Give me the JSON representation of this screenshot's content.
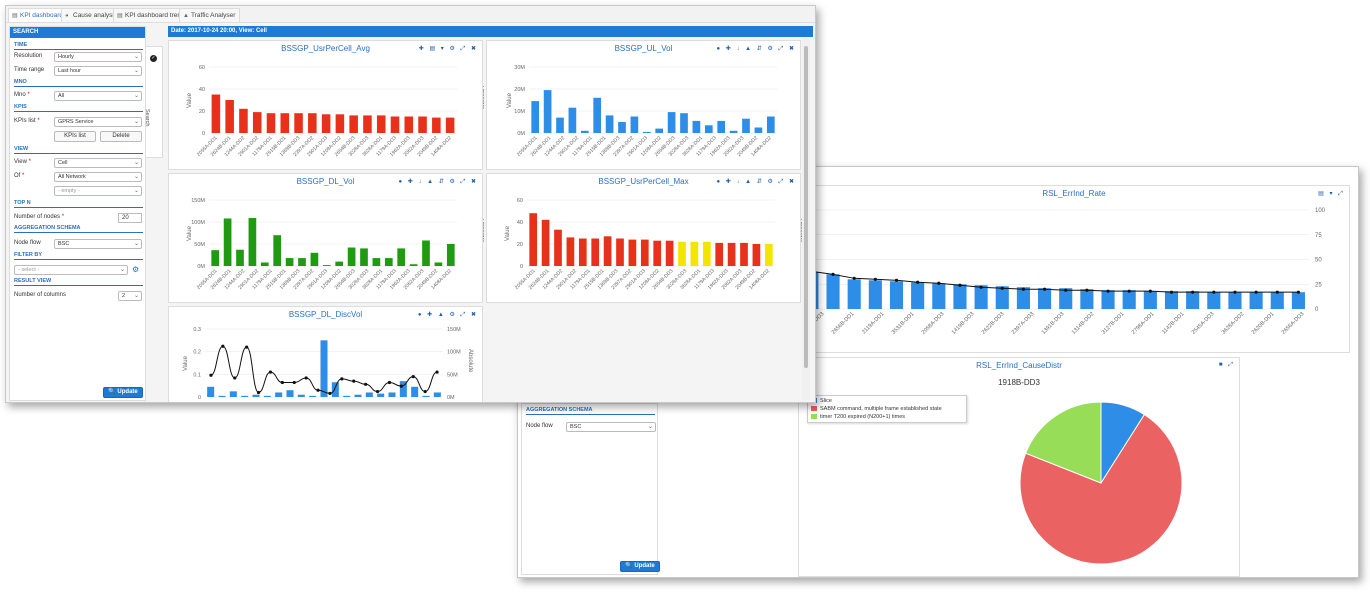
{
  "tabs": [
    {
      "label": "KPI dashboard",
      "icon": "chart-icon",
      "active": true
    },
    {
      "label": "Cause analysis",
      "icon": "pie-icon",
      "active": false
    },
    {
      "label": "KPI dashboard trend",
      "icon": "chart-icon",
      "active": false
    },
    {
      "label": "Traffic Analyser",
      "icon": "area-chart-icon",
      "active": false
    }
  ],
  "sidebar": {
    "title": "SEARCH",
    "sections": {
      "time": "TIME",
      "mno": "MNO",
      "kpis": "KPIS",
      "view": "VIEW",
      "topn": "TOP N",
      "aggregation": "AGGREGATION SCHEMA",
      "filter": "FILTER BY",
      "result": "RESULT VIEW"
    },
    "labels": {
      "resolution": "Resolution",
      "time_range": "Time range",
      "mno": "Mno",
      "kpis_list": "KPIs list",
      "view": "View",
      "of": "Of",
      "number_of_nodes": "Number of nodes",
      "node_flow": "Node flow",
      "number_of_columns": "Number of columns"
    },
    "values": {
      "resolution": "Hourly",
      "time_range": "Last hour",
      "mno": "All",
      "kpis_list": "GPRS Service",
      "view": "Cell",
      "of": "All Network",
      "of2_placeholder": "- empty -",
      "number_of_nodes": "20",
      "node_flow": "BSC",
      "filter_placeholder": "- select -",
      "number_of_columns": "2"
    },
    "buttons": {
      "kpis_list": "KPIs list",
      "delete": "Delete",
      "update": "Update"
    },
    "required_mark": "*",
    "search_tab": "Search"
  },
  "date_bar": "Date: 2017-10-24 20:00, View: Cell",
  "back_window": {
    "aggregation": "AGGREGATION SCHEMA",
    "node_flow_label": "Node flow",
    "node_flow_value": "BSC",
    "update": "Update"
  },
  "colors": {
    "accent": "#1f7ad6",
    "blue_bar": "#2e8de6",
    "red_bar": "#e8311a",
    "green_bar": "#1f9a12",
    "yellow_bar": "#f2e600",
    "pie_red": "#ea6262",
    "pie_green": "#97dd57",
    "pie_blue": "#2e8de6"
  },
  "chart_data": [
    {
      "id": "c1",
      "type": "bar",
      "title": "BSSGP_UsrPerCell_Avg",
      "ylabel": "Value",
      "y2label": "Absolute",
      "ylim": [
        0,
        60
      ],
      "yticks": [
        "0",
        "20",
        "40",
        "60"
      ],
      "categories": [
        "2055A-DD1",
        "2624B-DD1",
        "1244A-DD2",
        "2901A-DD2",
        "1179A-DD1",
        "2515B-DD1",
        "1369B-DD3",
        "2397A-DD2",
        "2901A-DD3",
        "1209A-DD2",
        "2654B-DD3",
        "3028A-DD3",
        "3628A-DD1",
        "1179A-DD3",
        "1962A-DD3",
        "2062A-DD3",
        "2049B-DD2",
        "1408A-DD2"
      ],
      "values": [
        35,
        30,
        22,
        19,
        18,
        18,
        18,
        18,
        17,
        17,
        16,
        16,
        16,
        15,
        15,
        15,
        14,
        14
      ],
      "colors": [
        "red"
      ]
    },
    {
      "id": "c2",
      "type": "bar",
      "title": "BSSGP_UL_Vol",
      "ylabel": "Value",
      "y2label": "Absolute",
      "ylim": [
        0,
        30
      ],
      "yticks": [
        "0M",
        "10M",
        "20M",
        "30M"
      ],
      "categories": [
        "2055A-DD1",
        "2624B-DD1",
        "1244A-DD2",
        "2901A-DD2",
        "1179A-DD1",
        "2515B-DD1",
        "1369B-DD3",
        "2397A-DD2",
        "2901A-DD3",
        "1209A-DD2",
        "2654B-DD3",
        "3028A-DD3",
        "3628A-DD1",
        "1179A-DD3",
        "1962A-DD3",
        "2062A-DD3",
        "2049B-DD2",
        "1408A-DD2"
      ],
      "values": [
        14.5,
        19.5,
        7,
        11.5,
        1,
        16,
        8,
        5,
        7.5,
        0.5,
        2,
        9.5,
        9,
        5.5,
        3.5,
        5.5,
        1,
        6.5,
        2.5,
        7.5
      ],
      "colors": [
        "blue"
      ]
    },
    {
      "id": "c3",
      "type": "bar",
      "title": "BSSGP_DL_Vol",
      "ylabel": "Value",
      "y2label": "Absolute",
      "ylim": [
        0,
        150
      ],
      "yticks": [
        "0M",
        "50M",
        "100M",
        "150M"
      ],
      "categories": [
        "2055A-DD1",
        "2624B-DD1",
        "1244A-DD2",
        "2901A-DD2",
        "1179A-DD1",
        "2515B-DD1",
        "1369B-DD3",
        "2397A-DD2",
        "2901A-DD3",
        "1209A-DD2",
        "2654B-DD3",
        "3028A-DD3",
        "3628A-DD1",
        "1179A-DD3",
        "1962A-DD3",
        "2062A-DD3",
        "2049B-DD2",
        "1408A-DD2"
      ],
      "values": [
        36,
        108,
        37,
        109,
        8,
        70,
        18,
        18,
        30,
        2,
        10,
        42,
        40,
        18,
        18,
        40,
        4,
        58,
        8,
        50
      ],
      "colors": [
        "green"
      ]
    },
    {
      "id": "c4",
      "type": "bar",
      "title": "BSSGP_UsrPerCell_Max",
      "ylabel": "Value",
      "y2label": "Absolute",
      "ylim": [
        0,
        60
      ],
      "yticks": [
        "0",
        "20",
        "40",
        "60"
      ],
      "categories": [
        "2055A-DD1",
        "2624B-DD1",
        "1244A-DD2",
        "2901A-DD2",
        "1179A-DD1",
        "2515B-DD1",
        "1369B-DD3",
        "2397A-DD2",
        "2901A-DD3",
        "1209A-DD2",
        "2654B-DD3",
        "3028A-DD3",
        "3628A-DD1",
        "1179A-DD3",
        "1962A-DD3",
        "2062A-DD3",
        "2049B-DD2",
        "1408A-DD2"
      ],
      "values": [
        48,
        42,
        33,
        26,
        25,
        25,
        27,
        25,
        24,
        24,
        23,
        23,
        22,
        22,
        22,
        21,
        21,
        21,
        20,
        20
      ],
      "bar_colors": [
        "red",
        "red",
        "red",
        "red",
        "red",
        "red",
        "red",
        "red",
        "red",
        "red",
        "red",
        "red",
        "yellow",
        "yellow",
        "yellow",
        "red",
        "red",
        "red",
        "red",
        "yellow",
        "red",
        "red"
      ]
    },
    {
      "id": "c5",
      "type": "bar",
      "title": "BSSGP_DL_DiscVol",
      "ylabel": "Value",
      "y2label": "Absolute",
      "ylim": [
        0,
        0.3
      ],
      "yticks": [
        "0",
        "0.1",
        "0.2",
        "0.3"
      ],
      "y2ticks": [
        "0M",
        "50M",
        "100M",
        "150M"
      ],
      "values": [
        0.045,
        0.005,
        0.025,
        0.005,
        0.01,
        0.005,
        0.02,
        0.03,
        0.01,
        0.005,
        0.25,
        0.065,
        0.005,
        0.01,
        0.02,
        0.015,
        0.02,
        0.07,
        0.045,
        0.005,
        0.02
      ],
      "line": [
        48,
        112,
        42,
        110,
        10,
        55,
        32,
        32,
        42,
        15,
        8,
        40,
        35,
        28,
        12,
        32,
        24,
        45,
        12,
        55
      ],
      "colors": [
        "blue"
      ]
    },
    {
      "id": "c6",
      "type": "bar",
      "title": "RSL_ErrInd_Rate",
      "yticks": [
        "0",
        "25",
        "50",
        "75",
        "100"
      ],
      "ylim": [
        0,
        100
      ],
      "categories": [
        "2026B-DD3",
        "2656B-DD1",
        "2119A-DD1",
        "3531B-DD1",
        "2058A-DD3",
        "1419B-DD3",
        "2622B-DD3",
        "2397A-DD3",
        "1391B-DD3",
        "1314B-DD2",
        "3127B-DD1",
        "2798A-DD1",
        "1142B-DD1",
        "2545A-DD3",
        "3628A-DD2",
        "2620B-DD1",
        "2656A-DD3"
      ],
      "values": [
        41,
        39,
        37,
        35,
        30,
        29,
        28,
        27,
        26,
        25,
        24,
        23,
        22,
        21,
        21,
        20,
        19,
        19,
        18,
        18,
        18,
        17,
        17,
        17,
        17,
        17
      ],
      "line": [
        42,
        40,
        38,
        35,
        31,
        30,
        29,
        27,
        26,
        24,
        22,
        21,
        20,
        20,
        19,
        19,
        18,
        18,
        18,
        17,
        17,
        17,
        17,
        17,
        17,
        17
      ],
      "colors": [
        "blue"
      ]
    },
    {
      "id": "c7",
      "type": "pie",
      "title": "RSL_ErrInd_CauseDistr",
      "subtitle": "1918B-DD3",
      "slices": [
        {
          "label": "Slice",
          "value": 9,
          "color": "blue"
        },
        {
          "label": "SABM command, multiple frame established state",
          "value": 72,
          "color": "red"
        },
        {
          "label": "timer T200 expired (N200+1) times",
          "value": 19,
          "color": "green"
        }
      ]
    }
  ]
}
